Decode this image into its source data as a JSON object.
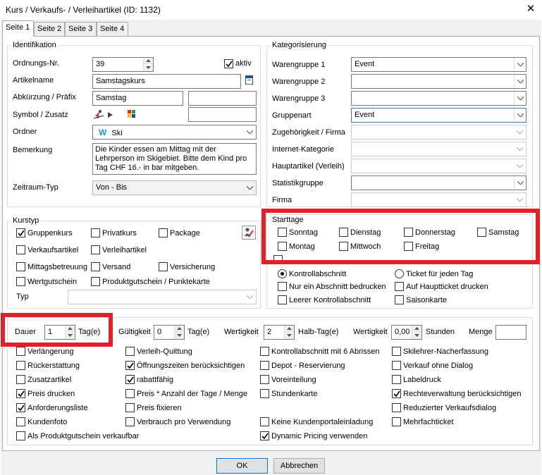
{
  "window": {
    "title": "Kurs / Verkaufs- / Verleihartikel (ID: 1132)",
    "close_symbol": "✕"
  },
  "tabs": [
    {
      "label": "Seite 1",
      "active": true
    },
    {
      "label": "Seite 2",
      "active": false
    },
    {
      "label": "Seite 3",
      "active": false
    },
    {
      "label": "Seite 4",
      "active": false
    }
  ],
  "identifikation": {
    "title": "Identifikation",
    "ordnungs_label": "Ordnungs-Nr.",
    "ordnungs_value": "39",
    "aktiv_label": "aktiv",
    "artikelname_label": "Artikelname",
    "artikelname_value": "Samstagskurs",
    "abk_label": "Abkürzung / Präfix",
    "abk_value": "Samstag",
    "abk_value2": "",
    "symbol_label": "Symbol / Zusatz",
    "symbol_value": "",
    "ordner_label": "Ordner",
    "ordner_icon_letter": "W",
    "ordner_value": "Ski",
    "bemerkung_label": "Bemerkung",
    "bemerkung_value": "Die Kinder essen am Mittag mit der Lehrperson im Skigebiet. Bitte dem Kind pro Tag CHF 16.- in bar mitgeben.",
    "zeitraum_label": "Zeitraum-Typ",
    "zeitraum_value": "Von - Bis"
  },
  "kategorisierung": {
    "title": "Kategorisierung",
    "rows": [
      {
        "label": "Warengruppe 1",
        "value": "Event"
      },
      {
        "label": "Warengruppe 2",
        "value": ""
      },
      {
        "label": "Warengruppe 3",
        "value": ""
      },
      {
        "label": "Gruppenart",
        "value": "Event"
      },
      {
        "label": "Zugehörigkeit / Firma",
        "value": ""
      },
      {
        "label": "Internet-Kategorie",
        "value": ""
      },
      {
        "label": "Hauptartikel (Verleih)",
        "value": ""
      },
      {
        "label": "Statistikgruppe",
        "value": ""
      },
      {
        "label": "Firma",
        "value": ""
      }
    ]
  },
  "kurstyp": {
    "title": "Kurstyp",
    "items": [
      "Gruppenkurs",
      "Privatkurs",
      "Package",
      "Verkaufsartikel",
      "Verleihartikel",
      "Mittagsbetreuung",
      "Versand",
      "Versicherung",
      "Wertgutschein",
      "Produktgutschein / Punktekarte"
    ],
    "typ_label": "Typ",
    "typ_value": ""
  },
  "starttage": {
    "title": "Starttage",
    "days": [
      "Sonntag",
      "Dienstag",
      "Donnerstag",
      "Samstag",
      "Montag",
      "Mittwoch",
      "Freitag"
    ]
  },
  "ticket": {
    "radios": [
      "Kontrollabschnitt",
      "Ticket für jeden Tag"
    ],
    "checks": [
      "Nur ein Abschnitt bedrucken",
      "Auf Hauptticket drucken",
      "Leerer Kontrollabschnitt",
      "Saisonkarte"
    ]
  },
  "eigenschaften": {
    "dauer_label": "Dauer",
    "dauer_value": "1",
    "dauer_unit": "Tag(e)",
    "gueltigkeit_label": "Gültigkeit",
    "gueltigkeit_value": "0",
    "gueltigkeit_unit": "Tag(e)",
    "wertigkeit1_label": "Wertigkeit",
    "wertigkeit1_value": "2",
    "wertigkeit1_unit": "Halb-Tag(e)",
    "wertigkeit2_label": "Wertigkeit",
    "wertigkeit2_value": "0,00",
    "wertigkeit2_unit": "Stunden",
    "menge_label": "Menge",
    "menge_value": "",
    "options": [
      "Verlängerung",
      "Verleih-Quittung",
      "Kontrollabschnitt mit 6 Abrissen",
      "Skilehrer-Nacherfassung",
      "Rückerstattung",
      "Öffnungszeiten berücksichtigen",
      "Depot - Reservierung",
      "Verkauf ohne Dialog",
      "Zusatzartikel",
      "rabattfähig",
      "Voreinteilung",
      "Labeldruck",
      "Preis drucken",
      "Preis * Anzahl der Tage / Menge",
      "Stundenkarte",
      "Rechteverwaltung berücksichtigen",
      "Anforderungsliste",
      "Preis fixieren",
      "Reduzierter Verkaufsdialog",
      "Kundenfoto",
      "Verbrauch pro Verwendung",
      "Keine Kundenportaleinladung",
      "Mehrfachticket",
      "Als Produktgutschein verkaufbar",
      "Dynamic Pricing verwenden"
    ]
  },
  "buttons": {
    "ok": "OK",
    "cancel": "Abbrechen"
  },
  "colors": {
    "highlight": "#e2202a",
    "focus_border": "#3c7fb1",
    "icon_blue": "#1a9ad6"
  }
}
